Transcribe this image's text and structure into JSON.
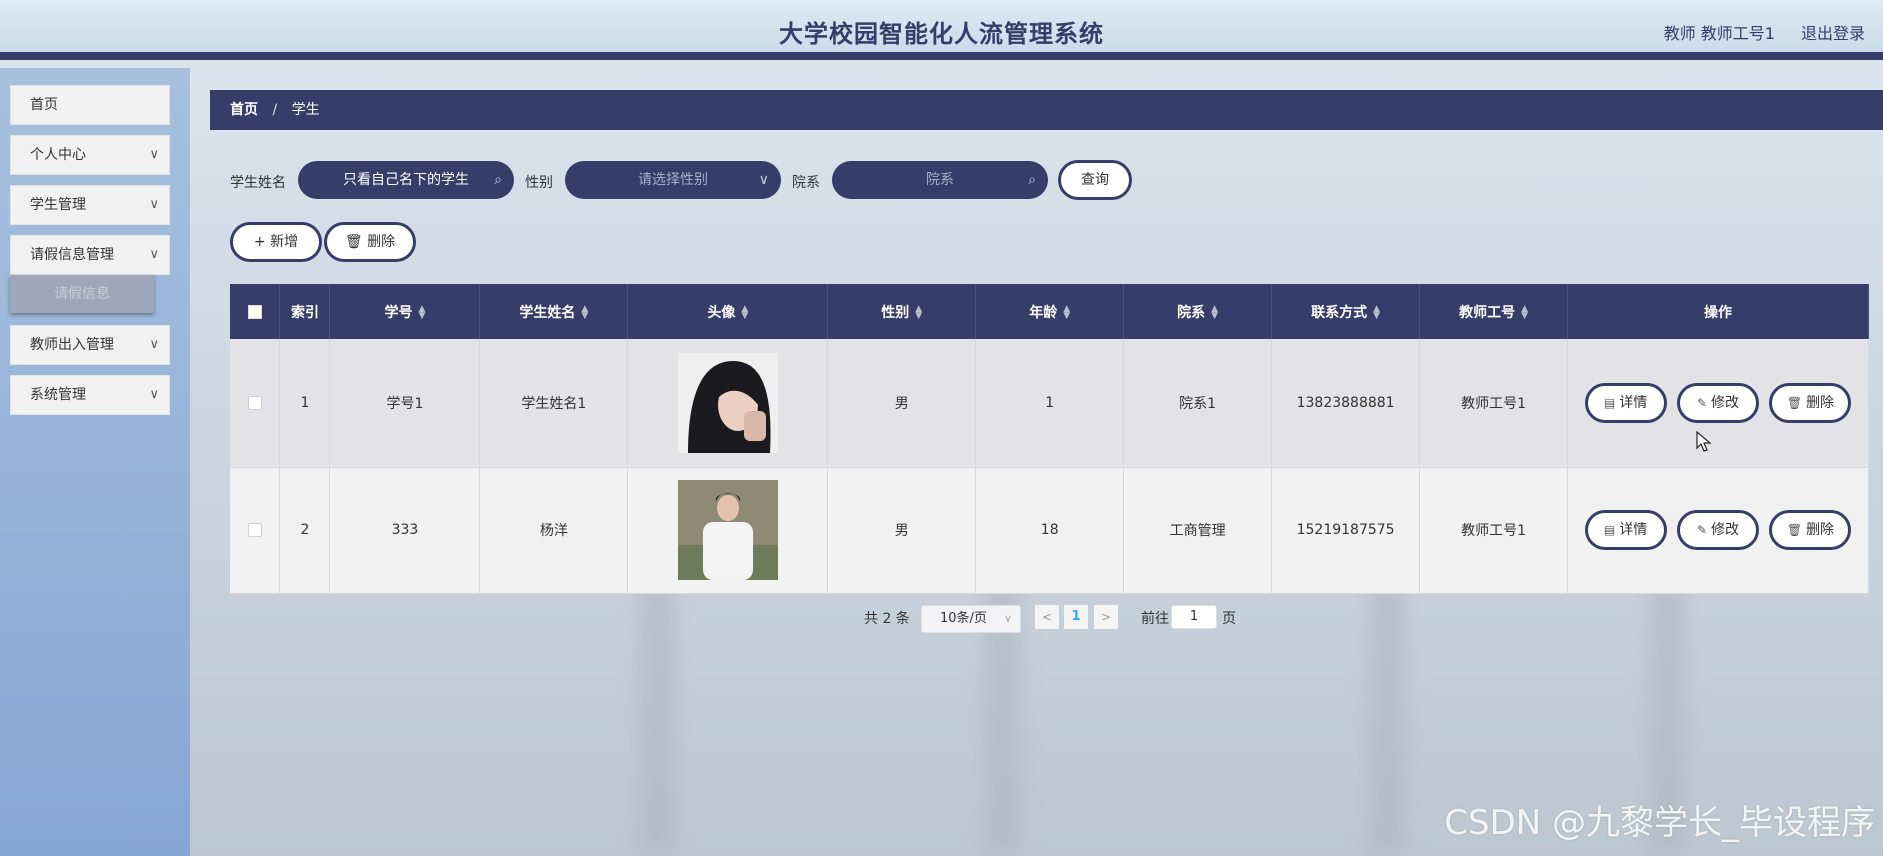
{
  "header": {
    "title": "大学校园智能化人流管理系统",
    "user": "教师 教师工号1",
    "logout": "退出登录"
  },
  "sidebar": {
    "items": [
      {
        "label": "首页"
      },
      {
        "label": "个人中心"
      },
      {
        "label": "学生管理"
      },
      {
        "label": "请假信息管理"
      },
      {
        "label": "教师出入管理"
      },
      {
        "label": "系统管理"
      }
    ],
    "submenu": {
      "label": "请假信息"
    }
  },
  "breadcrumb": {
    "home": "首页",
    "separator": "/",
    "current": "学生"
  },
  "filters": {
    "name_label": "学生姓名",
    "name_value": "只看自己名下的学生",
    "gender_label": "性别",
    "gender_placeholder": "请选择性别",
    "dept_label": "院系",
    "dept_placeholder": "院系",
    "query_button": "查询"
  },
  "toolbar": {
    "add_button": "新增",
    "delete_button": "删除"
  },
  "table": {
    "columns": [
      "索引",
      "学号",
      "学生姓名",
      "头像",
      "性别",
      "年龄",
      "院系",
      "联系方式",
      "教师工号",
      "操作"
    ],
    "rows": [
      {
        "index": "1",
        "student_no": "学号1",
        "name": "学生姓名1",
        "gender": "男",
        "age": "1",
        "dept": "院系1",
        "phone": "13823888881",
        "teacher_no": "教师工号1"
      },
      {
        "index": "2",
        "student_no": "333",
        "name": "杨洋",
        "gender": "男",
        "age": "18",
        "dept": "工商管理",
        "phone": "15219187575",
        "teacher_no": "教师工号1"
      }
    ],
    "actions": {
      "detail": "详情",
      "edit": "修改",
      "delete": "删除"
    }
  },
  "pagination": {
    "total": "共 2 条",
    "page_size": "10条/页",
    "current_page": "1",
    "goto_label": "前往",
    "goto_value": "1",
    "page_suffix": "页"
  },
  "watermark": "CSDN @九黎学长_毕设程序",
  "colors": {
    "primary": "#353d68",
    "header_bg": "#d3e2ef",
    "sidebar_bg": "#8fadd8",
    "row_odd": "#e2e2e7",
    "row_even": "#f1f1f1"
  }
}
